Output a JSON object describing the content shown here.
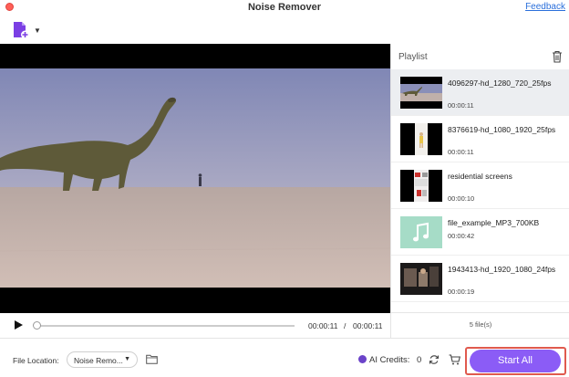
{
  "window": {
    "title": "Noise Remover",
    "feedback_link": "Feedback"
  },
  "toolbar": {
    "add_file_icon": "add-file-icon"
  },
  "playlist": {
    "title": "Playlist",
    "items": [
      {
        "name": "4096297-hd_1280_720_25fps",
        "duration": "00:00:11"
      },
      {
        "name": "8376619-hd_1080_1920_25fps",
        "duration": "00:00:11"
      },
      {
        "name": "residential screens",
        "duration": "00:00:10"
      },
      {
        "name": "file_example_MP3_700KB",
        "duration": "00:00:42"
      },
      {
        "name": "1943413-hd_1920_1080_24fps",
        "duration": "00:00:19"
      }
    ],
    "count": "5 file(s)"
  },
  "player": {
    "current_time": "00:00:11",
    "separator": "/",
    "total_time": "00:00:11",
    "progress": 0.0
  },
  "footer": {
    "file_location_label": "File Location:",
    "file_location_value": "Noise Remo...",
    "ai_credits_label": "AI Credits:",
    "ai_credits_value": "0",
    "start_button": "Start All"
  },
  "colors": {
    "accent": "#8b5cf6",
    "highlight_outline": "#e05a4e",
    "link": "#2a6fdb"
  }
}
